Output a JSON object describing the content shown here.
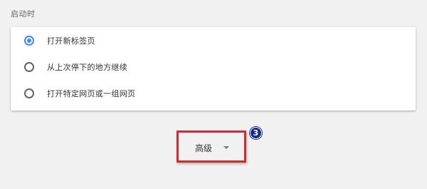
{
  "section": {
    "title": "启动时"
  },
  "startup_options": [
    {
      "label": "打开新标签页",
      "selected": true
    },
    {
      "label": "从上次停下的地方继续",
      "selected": false
    },
    {
      "label": "打开特定网页或一组网页",
      "selected": false
    }
  ],
  "advanced": {
    "label": "高级",
    "icon": "chevron-down-icon"
  },
  "annotation": {
    "step_number": "3",
    "highlight_color": "#d32b2b",
    "badge_color": "#1a2c8a"
  },
  "colors": {
    "accent": "#4285f4",
    "background": "#f1f1f1"
  }
}
